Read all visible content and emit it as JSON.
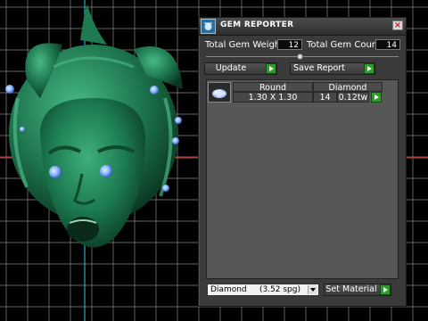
{
  "colors": {
    "viewport_bg": "#000000",
    "grid_line": "#8a8a8a",
    "axis_blue": "#2aa7c8",
    "axis_red": "#c8301f",
    "model_green": "#1f7a52",
    "gem_blue": "#7fb2ff",
    "panel_bg": "#3a3a3a",
    "go_green": "#2f9b2c"
  },
  "panel": {
    "title": "GEM REPORTER",
    "close_icon": "close-icon",
    "total_weight_label": "Total Gem Weight",
    "total_weight_value": "12",
    "total_count_label": "Total Gem Count",
    "total_count_value": "14",
    "update_label": "Update",
    "save_report_label": "Save Report"
  },
  "gem_table": {
    "headers": [
      "Round",
      "Diamond"
    ],
    "rows": [
      {
        "size": "1.30 X 1.30",
        "count": "14",
        "weight": "0.12tw"
      }
    ]
  },
  "footer": {
    "material_value": "Diamond     (3.52 spg)",
    "set_material_label": "Set Material"
  }
}
